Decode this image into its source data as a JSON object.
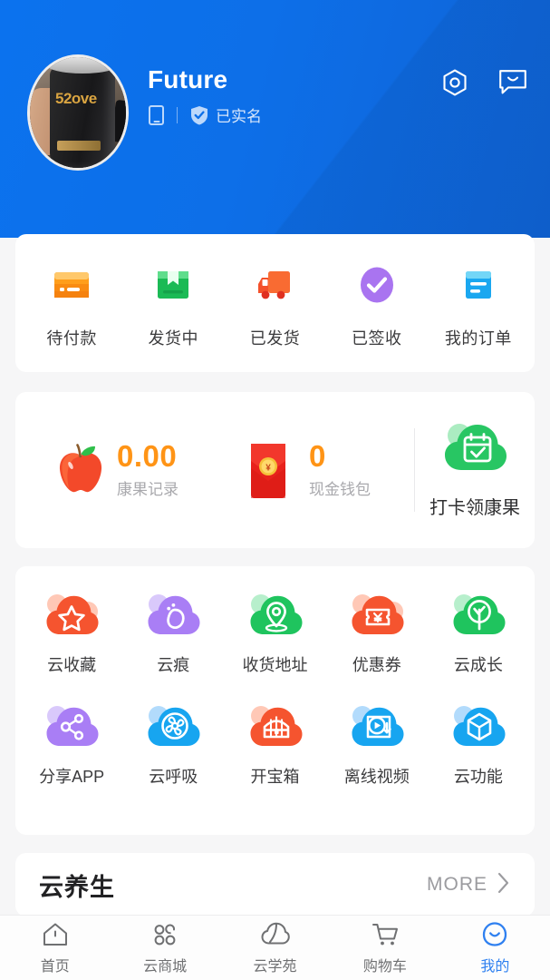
{
  "theme": {
    "header_blue_from": "#0b72ee",
    "header_blue_to": "#0f63d6",
    "page_bg": "#f6f6f7",
    "card_bg": "#ffffff",
    "accent_orange": "#ff9416",
    "accent_blue": "#2f80f0",
    "label_gray": "#3b3b3d",
    "muted_gray": "#a9a9ad"
  },
  "header": {
    "username": "Future",
    "avatar_alt": "52ove-tumbler-photo",
    "phone_icon": "phone-icon",
    "verify_icon": "shield-check-icon",
    "verify_label": "已实名",
    "actions": [
      {
        "name": "scan-settings-icon",
        "icon": "hexagon-camera-icon"
      },
      {
        "name": "message-icon",
        "icon": "chat-bubble-icon"
      }
    ]
  },
  "orders": {
    "items": [
      {
        "label": "待付款",
        "icon": "wallet-card-icon"
      },
      {
        "label": "发货中",
        "icon": "package-bookmark-icon"
      },
      {
        "label": "已发货",
        "icon": "delivery-truck-icon"
      },
      {
        "label": "已签收",
        "icon": "check-circle-icon"
      },
      {
        "label": "我的订单",
        "icon": "order-list-icon"
      }
    ]
  },
  "wallet": {
    "points": {
      "value": "0.00",
      "label": "康果记录",
      "icon": "apple-icon"
    },
    "cash": {
      "value": "0",
      "label": "现金钱包",
      "icon": "red-envelope-icon"
    },
    "checkin": {
      "label": "打卡领康果",
      "icon": "calendar-check-cloud-icon"
    }
  },
  "features": {
    "rows": [
      [
        {
          "label": "云收藏",
          "icon": "star-cloud-icon"
        },
        {
          "label": "云痕",
          "icon": "footprint-cloud-icon"
        },
        {
          "label": "收货地址",
          "icon": "location-pin-cloud-icon"
        },
        {
          "label": "优惠券",
          "icon": "coupon-cloud-icon"
        },
        {
          "label": "云成长",
          "icon": "tree-cloud-icon"
        }
      ],
      [
        {
          "label": "分享APP",
          "icon": "share-cloud-icon"
        },
        {
          "label": "云呼吸",
          "icon": "fan-cloud-icon"
        },
        {
          "label": "开宝箱",
          "icon": "treasure-chest-cloud-icon"
        },
        {
          "label": "离线视频",
          "icon": "video-download-cloud-icon"
        },
        {
          "label": "云功能",
          "icon": "cube-cloud-icon"
        }
      ]
    ]
  },
  "health": {
    "title": "云养生",
    "more_label": "MORE",
    "chevron": "chevron-right-icon"
  },
  "tabbar": {
    "items": [
      {
        "label": "首页",
        "icon": "home-icon",
        "active": false
      },
      {
        "label": "云商城",
        "icon": "grid-dots-icon",
        "active": false
      },
      {
        "label": "云学苑",
        "icon": "cloud-icon",
        "active": false
      },
      {
        "label": "购物车",
        "icon": "cart-icon",
        "active": false
      },
      {
        "label": "我的",
        "icon": "profile-icon",
        "active": true
      }
    ]
  }
}
